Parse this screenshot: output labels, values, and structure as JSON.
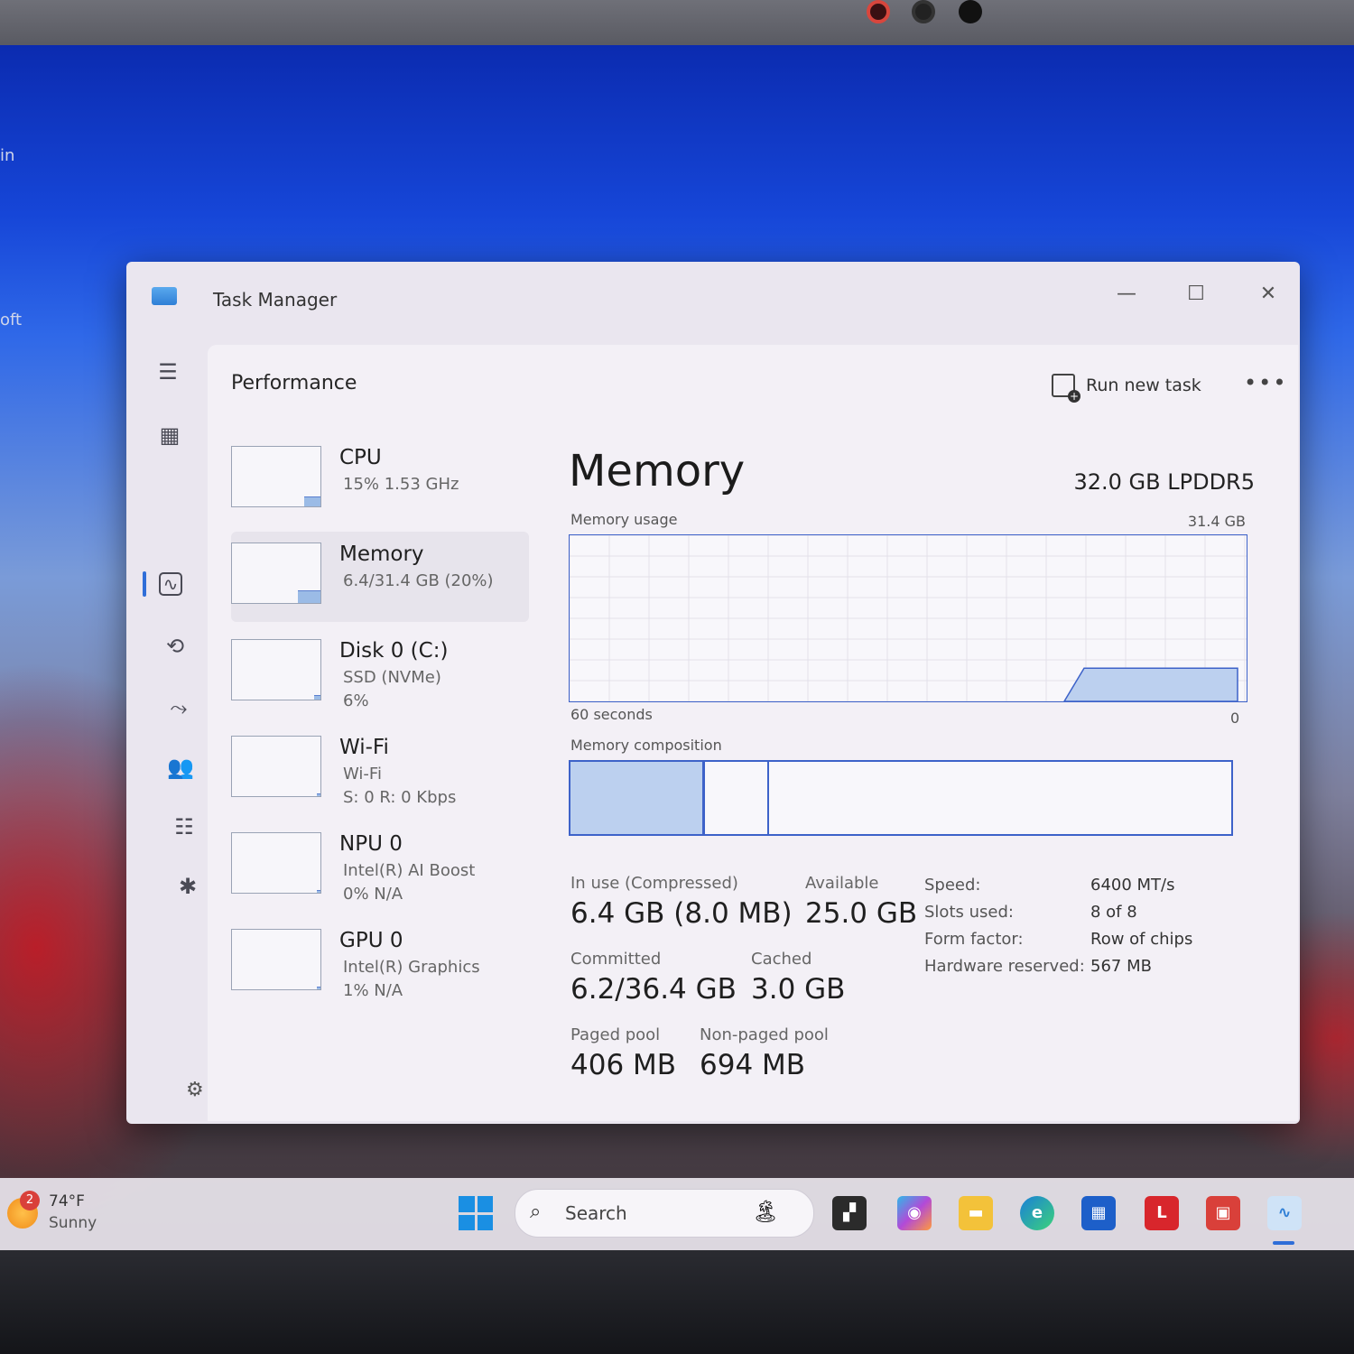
{
  "desktop": {
    "edge_text_1": "in",
    "edge_text_2": "oft"
  },
  "window": {
    "title": "Task Manager",
    "minimize": "—",
    "maximize": "☐",
    "close": "✕"
  },
  "header": {
    "title": "Performance",
    "run_task_label": "Run new task",
    "more_label": "•••"
  },
  "resources": [
    {
      "name": "CPU",
      "line1": "15%  1.53 GHz",
      "line2": "",
      "level": 0.15
    },
    {
      "name": "Memory",
      "line1": "6.4/31.4 GB (20%)",
      "line2": "",
      "level": 0.2
    },
    {
      "name": "Disk 0 (C:)",
      "line1": "SSD (NVMe)",
      "line2": "6%",
      "level": 0.06
    },
    {
      "name": "Wi-Fi",
      "line1": "Wi-Fi",
      "line2": "S: 0  R: 0 Kbps",
      "level": 0.0
    },
    {
      "name": "NPU 0",
      "line1": "Intel(R) AI Boost",
      "line2": "0%  N/A",
      "level": 0.0
    },
    {
      "name": "GPU 0",
      "line1": "Intel(R) Graphics",
      "line2": "1%  N/A",
      "level": 0.01
    }
  ],
  "memory": {
    "title": "Memory",
    "spec": "32.0 GB LPDDR5",
    "usage_label": "Memory usage",
    "usage_max": "31.4 GB",
    "time_label": "60 seconds",
    "time_end": "0",
    "usage_fraction": 0.2,
    "composition_label": "Memory composition",
    "composition": {
      "in_use_fraction": 0.2,
      "modified_fraction": 0.005,
      "standby_fraction": 0.095
    },
    "stats": {
      "in_use_label": "In use (Compressed)",
      "in_use_value": "6.4 GB (8.0 MB)",
      "available_label": "Available",
      "available_value": "25.0 GB",
      "committed_label": "Committed",
      "committed_value": "6.2/36.4 GB",
      "cached_label": "Cached",
      "cached_value": "3.0 GB",
      "paged_label": "Paged pool",
      "paged_value": "406 MB",
      "nonpaged_label": "Non-paged pool",
      "nonpaged_value": "694 MB"
    },
    "details": [
      {
        "label": "Speed:",
        "value": "6400 MT/s"
      },
      {
        "label": "Slots used:",
        "value": "8 of 8"
      },
      {
        "label": "Form factor:",
        "value": "Row of chips"
      },
      {
        "label": "Hardware reserved:",
        "value": "567 MB"
      }
    ]
  },
  "rail_icons": [
    "hamburger-icon",
    "processes-icon",
    "performance-icon",
    "app-history-icon",
    "startup-apps-icon",
    "users-icon",
    "details-icon",
    "services-icon",
    "settings-icon"
  ],
  "taskbar": {
    "weather_badge": "2",
    "weather_temp": "74°F",
    "weather_cond": "Sunny",
    "search_label": "Search"
  },
  "colors": {
    "accent": "#2f6ed8",
    "graph_line": "#3d62c9",
    "graph_fill": "#bcd0ef"
  }
}
